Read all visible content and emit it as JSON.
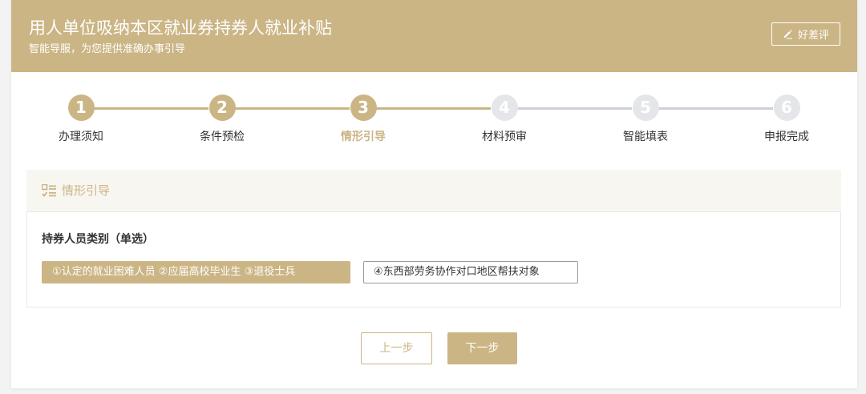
{
  "header": {
    "title": "用人单位吸纳本区就业券持券人就业补贴",
    "subtitle": "智能导服，为您提供准确办事引导",
    "rate_label": "好差评",
    "rate_icon": "pencil-icon"
  },
  "colors": {
    "accent": "#cbb585",
    "inactive": "#cdd1d6",
    "text": "#333333"
  },
  "steps": [
    {
      "number": "1",
      "label": "办理须知",
      "state": "done"
    },
    {
      "number": "2",
      "label": "条件预检",
      "state": "done"
    },
    {
      "number": "3",
      "label": "情形引导",
      "state": "active"
    },
    {
      "number": "4",
      "label": "材料预审",
      "state": "pending"
    },
    {
      "number": "5",
      "label": "智能填表",
      "state": "pending"
    },
    {
      "number": "6",
      "label": "申报完成",
      "state": "pending"
    }
  ],
  "section": {
    "title": "情形引导",
    "icon": "checklist-icon",
    "question": "持券人员类别（单选）",
    "options": [
      {
        "label": "①认定的就业困难人员 ②应届高校毕业生 ③退役士兵",
        "selected": true
      },
      {
        "label": "④东西部劳务协作对口地区帮扶对象",
        "selected": false
      }
    ]
  },
  "buttons": {
    "prev": "上一步",
    "next": "下一步"
  }
}
